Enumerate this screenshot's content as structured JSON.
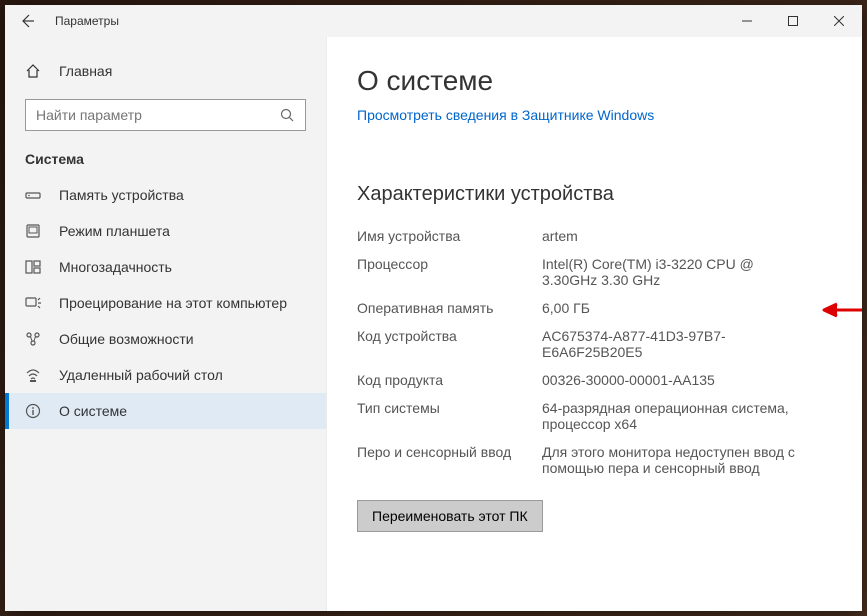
{
  "titlebar": {
    "title": "Параметры"
  },
  "sidebar": {
    "home_label": "Главная",
    "search_placeholder": "Найти параметр",
    "category": "Система",
    "items": [
      {
        "label": "Память устройства",
        "icon": "storage"
      },
      {
        "label": "Режим планшета",
        "icon": "tablet"
      },
      {
        "label": "Многозадачность",
        "icon": "multitask"
      },
      {
        "label": "Проецирование на этот компьютер",
        "icon": "project"
      },
      {
        "label": "Общие возможности",
        "icon": "shared"
      },
      {
        "label": "Удаленный рабочий стол",
        "icon": "remote"
      },
      {
        "label": "О системе",
        "icon": "about"
      }
    ]
  },
  "content": {
    "title": "О системе",
    "defender_link": "Просмотреть сведения в Защитнике Windows",
    "section_title": "Характеристики устройства",
    "specs": [
      {
        "label": "Имя устройства",
        "value": "artem"
      },
      {
        "label": "Процессор",
        "value": "Intel(R) Core(TM) i3-3220 CPU @ 3.30GHz   3.30 GHz"
      },
      {
        "label": "Оперативная память",
        "value": "6,00 ГБ",
        "highlight": true
      },
      {
        "label": "Код устройства",
        "value": "AC675374-A877-41D3-97B7-E6A6F25B20E5"
      },
      {
        "label": "Код продукта",
        "value": "00326-30000-00001-AA135"
      },
      {
        "label": "Тип системы",
        "value": "64-разрядная операционная система, процессор x64"
      },
      {
        "label": "Перо и сенсорный ввод",
        "value": "Для этого монитора недоступен ввод с помощью пера и сенсорный ввод"
      }
    ],
    "rename_button": "Переименовать этот ПК"
  }
}
